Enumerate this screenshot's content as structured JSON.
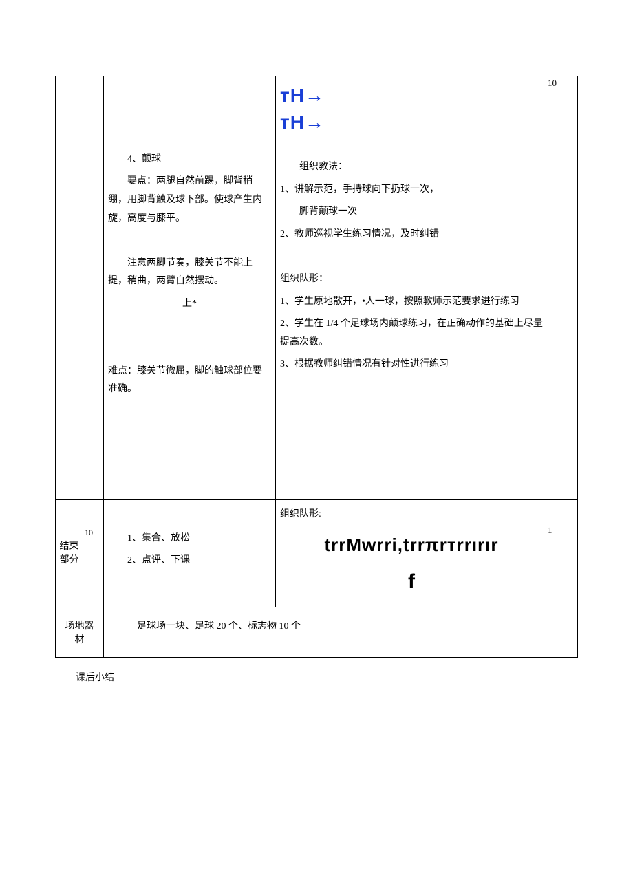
{
  "row1": {
    "content": {
      "item4_title": "4、颠球",
      "item4_keypoint": "要点：两腿自然前踢，脚背稍绷，用脚背触及球下部。使球产生内旋，高度与膝平。",
      "item4_note": "注意两脚节奏，膝关节不能上提，稍曲，两臂自然摆动。",
      "item4_up": "上*",
      "item4_diff": "难点：膝关节微屈，脚的触球部位要准确。"
    },
    "method": {
      "sym1": "тH→",
      "sym2": "тH→",
      "teach_label": "组织教法：",
      "teach1": "1、讲解示范，手持球向下扔球一次，",
      "teach1b": "脚背颠球一次",
      "teach2": "2、教师巡视学生练习情况，及时纠错",
      "form_label": "组织队形：",
      "form1": "1、学生原地散开，•人一球，按照教师示范要求进行练习",
      "form2": "2、学生在 1/4 个足球场内颠球练习，在正确动作的基础上尽量提高次数。",
      "form3": "3、根据教师纠错情况有针对性进行练习"
    },
    "n1": "10"
  },
  "row2": {
    "section": "结束部分",
    "time": "10",
    "content": {
      "c1": "1、集合、放松",
      "c2": "2、点评、下课"
    },
    "method": {
      "form_label": "组织队形:",
      "sym1": "trrMwrri,trrπrтrrırır",
      "sym2": "f"
    },
    "n1": "1"
  },
  "equipment": {
    "label": "场地器材",
    "value": "足球场一块、足球 20 个、标志物 10 个"
  },
  "after_note": "课后小结"
}
